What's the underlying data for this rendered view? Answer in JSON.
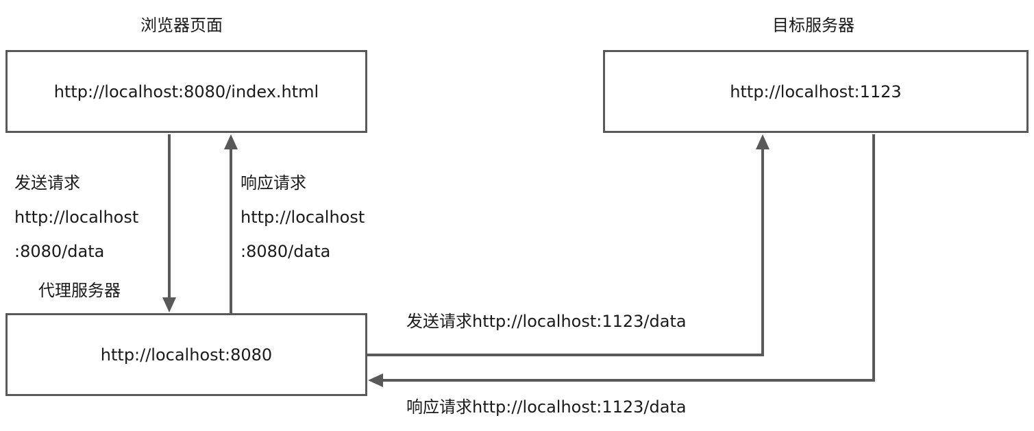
{
  "browser": {
    "title": "浏览器页面",
    "url": "http://localhost:8080/index.html"
  },
  "target": {
    "title": "目标服务器",
    "url": "http://localhost:1123"
  },
  "proxy": {
    "title": "代理服务器",
    "url": "http://localhost:8080"
  },
  "edges": {
    "browser_to_proxy": {
      "line1": "发送请求",
      "line2": "http://localhost",
      "line3": ":8080/data"
    },
    "proxy_to_browser": {
      "line1": "响应请求",
      "line2": "http://localhost",
      "line3": ":8080/data"
    },
    "proxy_to_target": {
      "label": "发送请求http://localhost:1123/data"
    },
    "target_to_proxy": {
      "label": "响应请求http://localhost:1123/data"
    }
  },
  "colors": {
    "stroke": "#595959",
    "text": "#1a1a1a",
    "background": "#ffffff"
  }
}
